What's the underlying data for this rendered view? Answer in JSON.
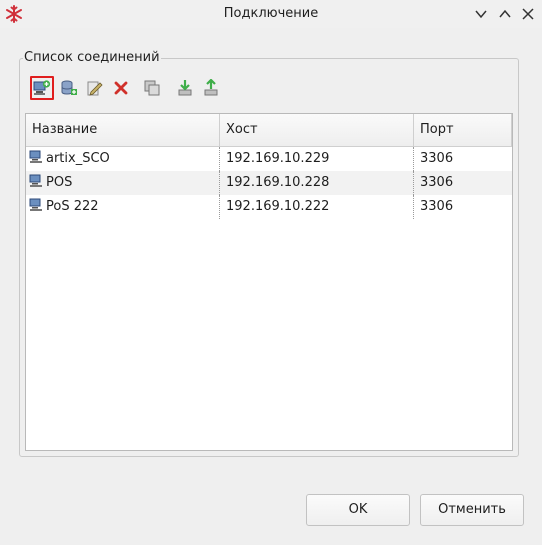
{
  "window": {
    "title": "Подключение",
    "icon": "snowflake-icon",
    "controls": [
      "chevron-down-icon",
      "chevron-up-icon",
      "close-icon"
    ]
  },
  "group": {
    "title": "Список соединений"
  },
  "toolbar": {
    "buttons": [
      {
        "icon": "new-connection-icon",
        "active": true
      },
      {
        "icon": "add-database-icon"
      },
      {
        "icon": "edit-icon"
      },
      {
        "icon": "delete-icon"
      },
      {
        "icon": "copy-icon"
      },
      {
        "icon": "import-icon"
      },
      {
        "icon": "export-icon"
      }
    ]
  },
  "table": {
    "columns": [
      "Название",
      "Хост",
      "Порт"
    ],
    "rows": [
      {
        "name": "artix_SCO",
        "host": "192.169.10.229",
        "port": "3306"
      },
      {
        "name": "POS",
        "host": "192.169.10.228",
        "port": "3306"
      },
      {
        "name": "PoS 222",
        "host": "192.169.10.222",
        "port": "3306"
      }
    ]
  },
  "buttons": {
    "ok": "OK",
    "cancel": "Отменить"
  },
  "colors": {
    "active_outline": "#e01e1e",
    "brand_icon": "#d0303a"
  }
}
